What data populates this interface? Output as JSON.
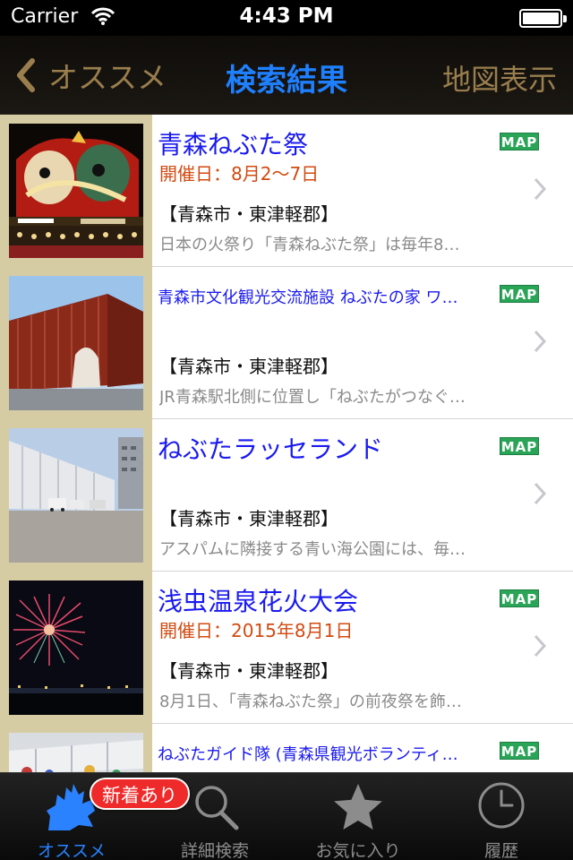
{
  "status": {
    "carrier": "Carrier",
    "time": "4:43 PM"
  },
  "nav": {
    "back_label": "オススメ",
    "title": "検索結果",
    "right_label": "地図表示"
  },
  "list": [
    {
      "title": "青森ねぶた祭",
      "date": "開催日：8月2〜7日",
      "area": "【青森市・東津軽郡】",
      "description": "日本の火祭り「青森ねぶた祭」は毎年8…",
      "map_label": "MAP"
    },
    {
      "title": "青森市文化観光交流施設 ねぶたの家 ワ…",
      "date": "",
      "area": "【青森市・東津軽郡】",
      "description": "JR青森駅北側に位置し「ねぶたがつなぐ…",
      "map_label": "MAP"
    },
    {
      "title": "ねぶたラッセランド",
      "date": "",
      "area": "【青森市・東津軽郡】",
      "description": "アスパムに隣接する青い海公園には、毎…",
      "map_label": "MAP"
    },
    {
      "title": "浅虫温泉花火大会",
      "date": "開催日：2015年8月1日",
      "area": "【青森市・東津軽郡】",
      "description": "8月1日、「青森ねぶた祭」の前夜祭を飾…",
      "map_label": "MAP"
    },
    {
      "title": "ねぶたガイド隊 (青森県観光ボランティ…",
      "date": "",
      "area": "",
      "description": "",
      "map_label": "MAP"
    }
  ],
  "tabs": [
    {
      "label": "オススメ",
      "icon": "aomori-map-icon",
      "active": true
    },
    {
      "label": "詳細検索",
      "icon": "magnifier-icon",
      "active": false
    },
    {
      "label": "お気に入り",
      "icon": "star-icon",
      "active": false
    },
    {
      "label": "履歴",
      "icon": "clock-icon",
      "active": false
    }
  ],
  "badge": {
    "label": "新着あり"
  },
  "colors": {
    "accent": "#1f80ff",
    "nav_gold": "#9a7e4d",
    "title_blue": "#1a1af0",
    "date_orange": "#d24a10",
    "map_green": "#2aa457",
    "badge_red": "#ee2a2a"
  }
}
